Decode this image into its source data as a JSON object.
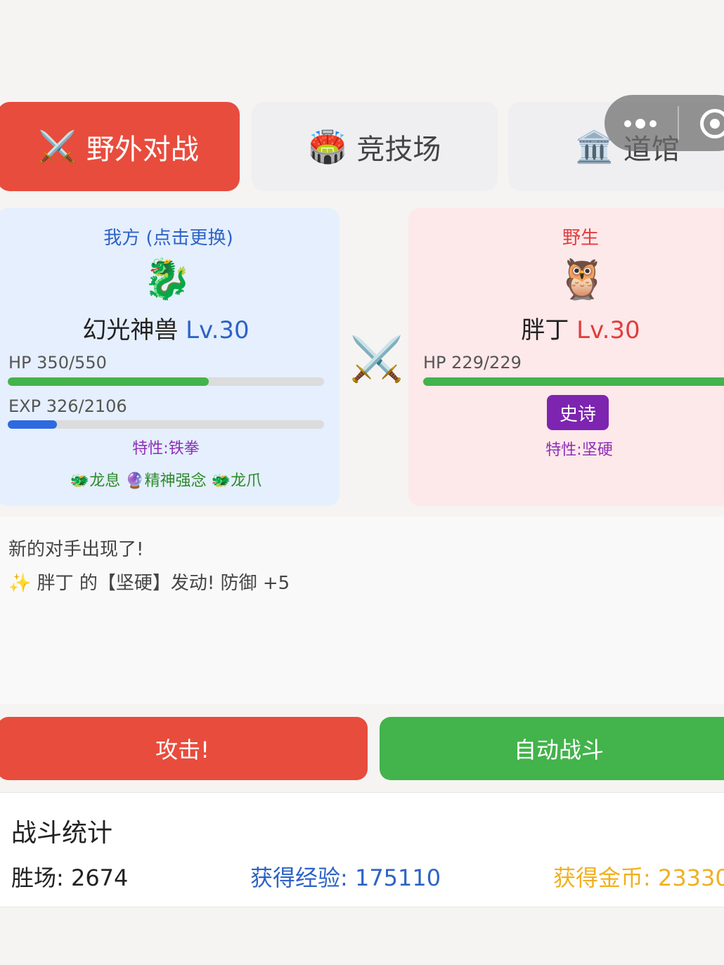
{
  "tabs": [
    {
      "icon": "⚔️",
      "label": "野外对战",
      "active": true
    },
    {
      "icon": "🏟️",
      "label": "竞技场",
      "active": false
    },
    {
      "icon": "🏛️",
      "label": "道馆",
      "active": false
    }
  ],
  "my_pokemon": {
    "side_label": "我方 (点击更换)",
    "sprite": "🐉",
    "name": "幻光神兽",
    "level": "Lv.30",
    "hp_text": "HP 350/550",
    "hp_fraction": 0.636,
    "exp_text": "EXP 326/2106",
    "exp_fraction": 0.155,
    "trait": "特性:铁拳",
    "skills": "🐲龙息 🔮精神强念 🐲龙爪"
  },
  "vs_icon": "⚔️",
  "enemy_pokemon": {
    "side_label": "野生",
    "sprite": "🦉",
    "name": "胖丁",
    "level": "Lv.30",
    "hp_text": "HP 229/229",
    "hp_fraction": 1.0,
    "rarity": "史诗",
    "trait": "特性:坚硬"
  },
  "battle_log": [
    "新的对手出现了!",
    "✨ 胖丁 的【坚硬】发动! 防御 +5"
  ],
  "actions": {
    "attack": "攻击!",
    "auto": "自动战斗"
  },
  "stats": {
    "title": "战斗统计",
    "wins": "胜场: 2674",
    "exp": "获得经验: 175110",
    "gold": "获得金币: 23330"
  },
  "colors": {
    "primary_red": "#e84c3d",
    "green": "#43b34c",
    "blue": "#2d63c6",
    "purple": "#7d24b0",
    "gold": "#f0b020"
  }
}
